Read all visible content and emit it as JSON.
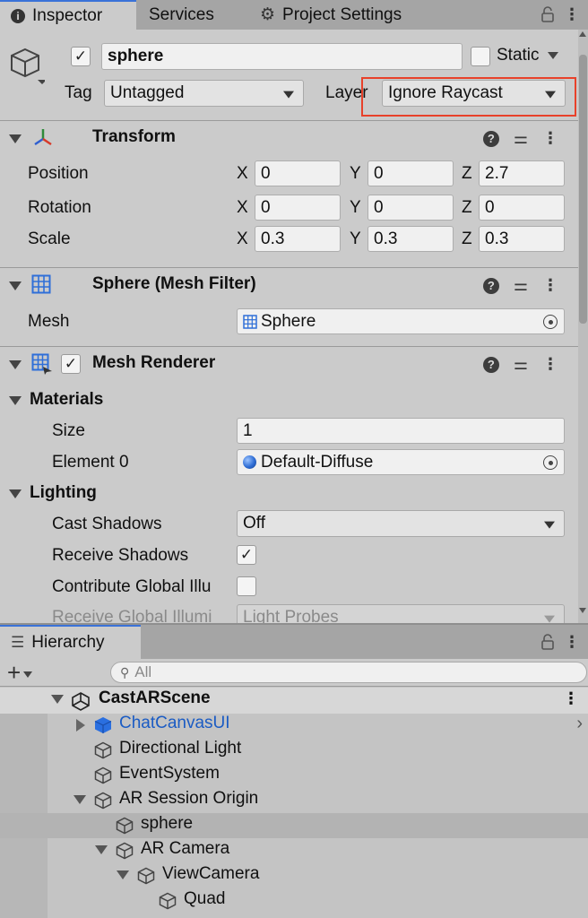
{
  "tabs": {
    "inspector": "Inspector",
    "services": "Services",
    "project_settings": "Project Settings"
  },
  "object": {
    "name": "sphere",
    "active": true,
    "static_label": "Static",
    "tag_label": "Tag",
    "tag_value": "Untagged",
    "layer_label": "Layer",
    "layer_value": "Ignore Raycast"
  },
  "transform": {
    "title": "Transform",
    "position_label": "Position",
    "rotation_label": "Rotation",
    "scale_label": "Scale",
    "x": "X",
    "y": "Y",
    "z": "Z",
    "position": {
      "x": "0",
      "y": "0",
      "z": "2.7"
    },
    "rotation": {
      "x": "0",
      "y": "0",
      "z": "0"
    },
    "scale": {
      "x": "0.3",
      "y": "0.3",
      "z": "0.3"
    }
  },
  "mesh_filter": {
    "title": "Sphere (Mesh Filter)",
    "mesh_label": "Mesh",
    "mesh_value": "Sphere"
  },
  "mesh_renderer": {
    "title": "Mesh Renderer",
    "enabled": true,
    "materials_label": "Materials",
    "size_label": "Size",
    "size_value": "1",
    "element0_label": "Element 0",
    "element0_value": "Default-Diffuse",
    "lighting_label": "Lighting",
    "cast_shadows_label": "Cast Shadows",
    "cast_shadows_value": "Off",
    "receive_shadows_label": "Receive Shadows",
    "contribute_gi_label": "Contribute Global Illu",
    "receive_gi_label": "Receive Global Illumi",
    "receive_gi_value": "Light Probes"
  },
  "hierarchy": {
    "tab": "Hierarchy",
    "search_placeholder": "All",
    "scene": "CastARScene",
    "items": [
      {
        "label": "ChatCanvasUI"
      },
      {
        "label": "Directional Light"
      },
      {
        "label": "EventSystem"
      },
      {
        "label": "AR Session Origin"
      },
      {
        "label": "sphere"
      },
      {
        "label": "AR Camera"
      },
      {
        "label": "ViewCamera"
      },
      {
        "label": "Quad"
      }
    ]
  },
  "colors": {
    "accent_blue": "#3a72d8",
    "highlight_red": "#e8412a",
    "prefab_blue": "#1b5cc4"
  }
}
